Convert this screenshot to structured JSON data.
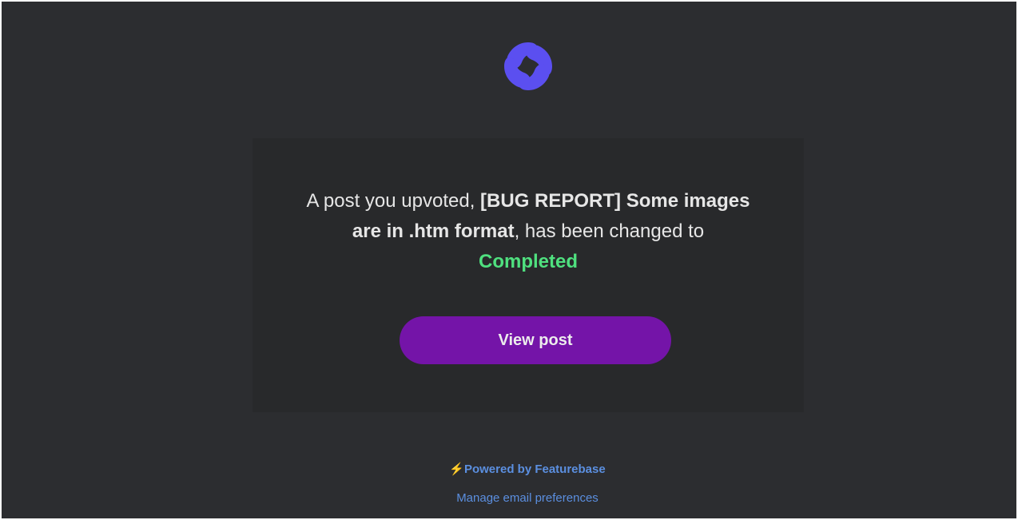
{
  "brand": {
    "logo_icon": "featurebase-logo-icon",
    "accent_color": "#5b4ff0"
  },
  "notification": {
    "prefix": "A post you upvoted, ",
    "post_title": "[BUG REPORT] Some images are in .htm format",
    "middle": ", has been changed to ",
    "status": "Completed",
    "status_color": "#4fe07f"
  },
  "actions": {
    "view_post_label": "View post",
    "button_color": "#7414a8"
  },
  "footer": {
    "bolt_glyph": "⚡",
    "powered_by": "Powered by Featurebase",
    "manage_preferences": "Manage email preferences",
    "link_color": "#5b8fe0"
  }
}
